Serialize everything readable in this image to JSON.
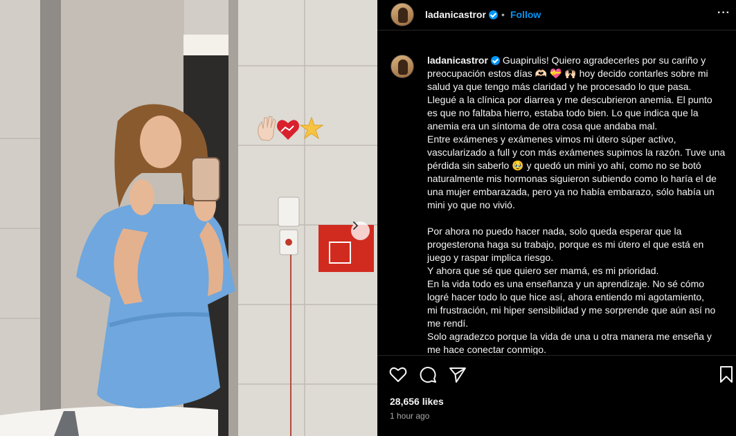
{
  "post": {
    "author": "ladanicastror",
    "follow_label": "Follow",
    "separator": "•",
    "more_label": "···",
    "photo_alt": "Mirror selfie in hospital gown",
    "overlay_emojis": [
      "hand-wave-light",
      "mending-heart",
      "star"
    ]
  },
  "caption": {
    "author": "ladanicastror",
    "lines": [
      " Guapirulis! Quiero agradecerles por su cariño y",
      "preocupación estos días 🫶🏻 💝 🙌🏻  hoy decido contarles sobre mi",
      "salud ya que tengo más claridad y he procesado lo que pasa.",
      "Llegué a la clínica por diarrea y me descubrieron anemia. El punto",
      "es que no faltaba hierro, estaba todo bien. Lo que indica que la",
      "anemia era un síntoma de otra cosa que andaba mal.",
      "Entre exámenes y exámenes vimos mi útero súper activo,",
      "vascularizado a full y con más exámenes supimos la razón. Tuve una",
      "pérdida sin saberlo 🥹  y quedó un mini yo ahí, como no se botó",
      "naturalmente mis hormonas siguieron subiendo como lo haría el de",
      "una mujer embarazada, pero ya no había embarazo, sólo había un",
      "mini yo que no vivió.",
      "",
      "Por ahora no puedo hacer nada, solo queda esperar que la",
      "progesterona haga su trabajo, porque es mi útero el que está en",
      "juego y raspar implica riesgo.",
      "Y ahora que sé que quiero ser mamá, es mi prioridad.",
      "En la vida todo es una enseñanza y un aprendizaje. No sé cómo",
      "logré hacer todo lo que hice así, ahora entiendo mi agotamiento,",
      "mi frustración, mi hiper sensibilidad y me sorprende que aún así no",
      "me rendí.",
      "Solo agradezco porque la vida de una u otra manera me enseña y",
      "me hace conectar conmigo."
    ]
  },
  "stats": {
    "likes": "28,656 likes",
    "time": "1 hour ago"
  },
  "colors": {
    "background": "#000000",
    "text": "#f5f5f5",
    "secondary": "#a8a8a8",
    "accent": "#0095f6",
    "border": "#262626"
  }
}
